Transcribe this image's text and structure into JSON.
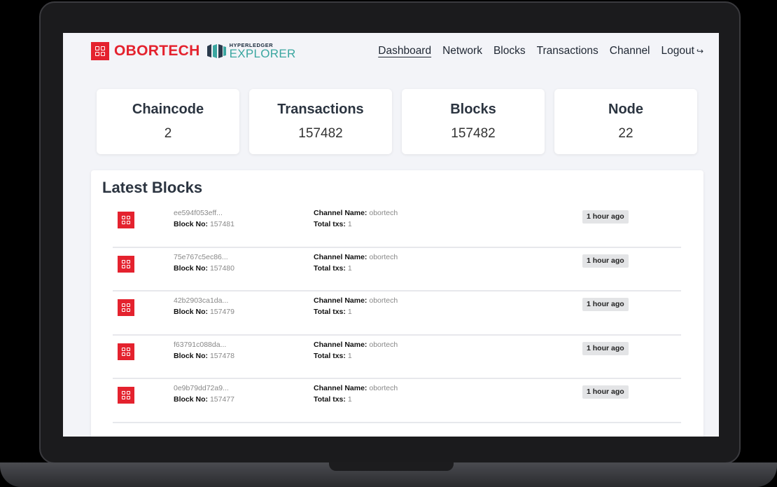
{
  "header": {
    "brand": "OBORTECH",
    "hyperledger_top": "HYPERLEDGER",
    "hyperledger_bottom": "EXPLORER",
    "nav": [
      "Dashboard",
      "Network",
      "Blocks",
      "Transactions",
      "Channel",
      "Logout"
    ],
    "active_nav": "Dashboard"
  },
  "stats": [
    {
      "label": "Chaincode",
      "value": "2"
    },
    {
      "label": "Transactions",
      "value": "157482"
    },
    {
      "label": "Blocks",
      "value": "157482"
    },
    {
      "label": "Node",
      "value": "22"
    }
  ],
  "latest_blocks": {
    "title": "Latest Blocks",
    "labels": {
      "block_no": "Block No:",
      "channel_name": "Channel Name:",
      "total_txs": "Total txs:"
    },
    "rows": [
      {
        "hash": "ee594f053eff...",
        "block_no": "157481",
        "channel": "obortech",
        "txs": "1",
        "time": "1 hour ago"
      },
      {
        "hash": "75e767c5ec86...",
        "block_no": "157480",
        "channel": "obortech",
        "txs": "1",
        "time": "1 hour ago"
      },
      {
        "hash": "42b2903ca1da...",
        "block_no": "157479",
        "channel": "obortech",
        "txs": "1",
        "time": "1 hour ago"
      },
      {
        "hash": "f63791c088da...",
        "block_no": "157478",
        "channel": "obortech",
        "txs": "1",
        "time": "1 hour ago"
      },
      {
        "hash": "0e9b79dd72a9...",
        "block_no": "157477",
        "channel": "obortech",
        "txs": "1",
        "time": "1 hour ago"
      }
    ]
  },
  "colors": {
    "brand_red": "#e4222e",
    "explorer_teal": "#3aa6a0"
  }
}
